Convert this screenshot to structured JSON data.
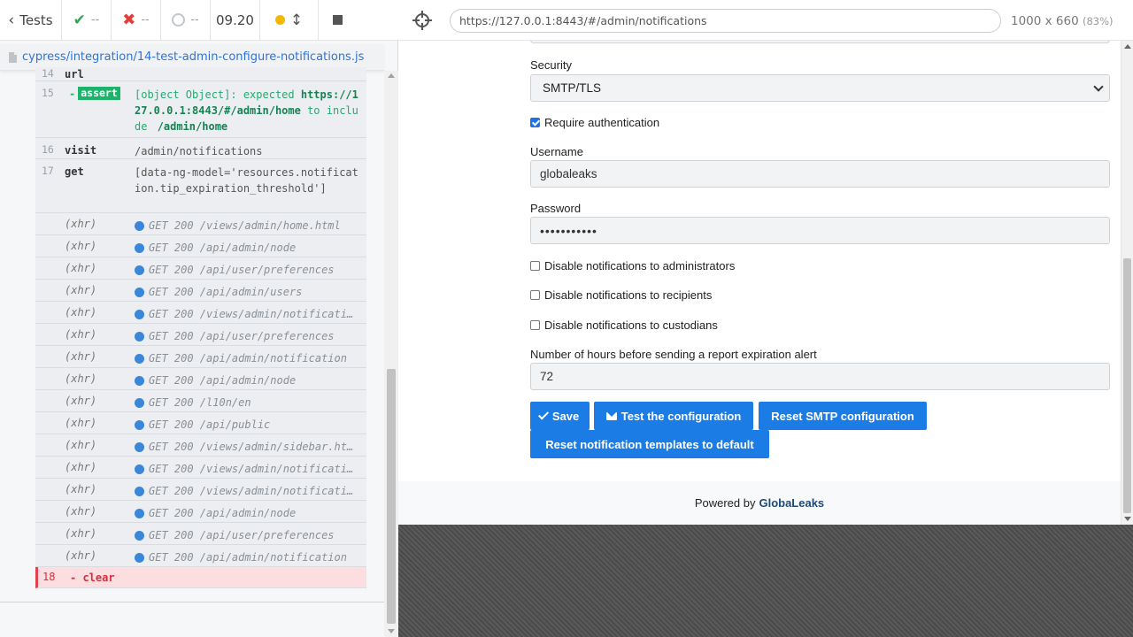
{
  "header": {
    "tests_label": "Tests",
    "passed": "--",
    "failed": "--",
    "pending": "--",
    "duration": "09.20"
  },
  "spec": {
    "path": "cypress/integration/14-test-admin-configure-notifications.js"
  },
  "commands": [
    {
      "num": "14",
      "name": "url",
      "message": ""
    },
    {
      "num": "15",
      "name": "assert",
      "msg_prefix": "[object Object]: expected",
      "msg_value": "https://127.0.0.1:8443/#/admin/home",
      "msg_mid": "to include",
      "msg_value2": "/admin/home"
    },
    {
      "num": "16",
      "name": "visit",
      "message": "/admin/notifications"
    },
    {
      "num": "17",
      "name": "get",
      "message": "[data-ng-model='resources.notification.tip_expiration_threshold']"
    }
  ],
  "xhr": [
    {
      "name": "(xhr)",
      "text": "GET 200 /views/admin/home.html"
    },
    {
      "name": "(xhr)",
      "text": "GET 200 /api/admin/node"
    },
    {
      "name": "(xhr)",
      "text": "GET 200 /api/user/preferences"
    },
    {
      "name": "(xhr)",
      "text": "GET 200 /api/admin/users"
    },
    {
      "name": "(xhr)",
      "text": "GET 200 /views/admin/notificati…"
    },
    {
      "name": "(xhr)",
      "text": "GET 200 /api/user/preferences"
    },
    {
      "name": "(xhr)",
      "text": "GET 200 /api/admin/notification"
    },
    {
      "name": "(xhr)",
      "text": "GET 200 /api/admin/node"
    },
    {
      "name": "(xhr)",
      "text": "GET 200 /l10n/en"
    },
    {
      "name": "(xhr)",
      "text": "GET 200 /api/public"
    },
    {
      "name": "(xhr)",
      "text": "GET 200 /views/admin/sidebar.ht…"
    },
    {
      "name": "(xhr)",
      "text": "GET 200 /views/admin/notificati…"
    },
    {
      "name": "(xhr)",
      "text": "GET 200 /views/admin/notificati…"
    },
    {
      "name": "(xhr)",
      "text": "GET 200 /api/admin/node"
    },
    {
      "name": "(xhr)",
      "text": "GET 200 /api/user/preferences"
    },
    {
      "name": "(xhr)",
      "text": "GET 200 /api/admin/notification"
    }
  ],
  "last_command": {
    "num": "18",
    "name": "clear"
  },
  "aut": {
    "url": "https://127.0.0.1:8443/#/admin/notifications",
    "viewport": "1000 x 660",
    "zoom": "(83%)"
  },
  "form": {
    "security_label": "Security",
    "security_value": "SMTP/TLS",
    "require_auth_label": "Require authentication",
    "require_auth_checked": true,
    "username_label": "Username",
    "username_value": "globaleaks",
    "password_label": "Password",
    "password_value": "•••••••••••",
    "disable_admins_label": "Disable notifications to administrators",
    "disable_recipients_label": "Disable notifications to recipients",
    "disable_custodians_label": "Disable notifications to custodians",
    "hours_label": "Number of hours before sending a report expiration alert",
    "hours_value": "72",
    "save_label": "Save",
    "test_label": "Test the configuration",
    "reset_smtp_label": "Reset SMTP configuration",
    "reset_templates_label": "Reset notification templates to default"
  },
  "footer": {
    "powered_by": "Powered by",
    "brand": "GlobaLeaks"
  },
  "colors": {
    "accent": "#1c7ce6",
    "pass": "#31a354",
    "fail": "#e23d3d",
    "assert": "#1db36a",
    "xhr_dot": "#3a86d8"
  }
}
